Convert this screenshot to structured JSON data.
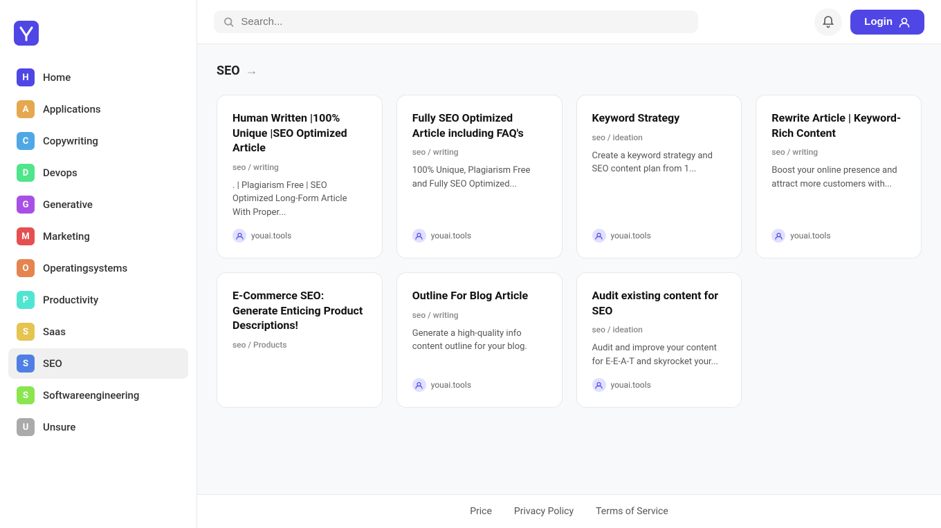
{
  "logo": {
    "alt": "Youai logo"
  },
  "sidebar": {
    "items": [
      {
        "id": "home",
        "label": "Home",
        "icon": "H",
        "color": "#4f46e5",
        "active": false
      },
      {
        "id": "applications",
        "label": "Applications",
        "icon": "A",
        "color": "#e5a84f",
        "active": false
      },
      {
        "id": "copywriting",
        "label": "Copywriting",
        "icon": "C",
        "color": "#4fa8e5",
        "active": false
      },
      {
        "id": "devops",
        "label": "Devops",
        "icon": "D",
        "color": "#4fe58a",
        "active": false
      },
      {
        "id": "generative",
        "label": "Generative",
        "icon": "G",
        "color": "#a84fe5",
        "active": false
      },
      {
        "id": "marketing",
        "label": "Marketing",
        "icon": "M",
        "color": "#e54f4f",
        "active": false
      },
      {
        "id": "operatingsystems",
        "label": "Operatingsystems",
        "icon": "O",
        "color": "#e5844f",
        "active": false
      },
      {
        "id": "productivity",
        "label": "Productivity",
        "icon": "P",
        "color": "#4fe5d0",
        "active": false
      },
      {
        "id": "saas",
        "label": "Saas",
        "icon": "S",
        "color": "#e5c44f",
        "active": false
      },
      {
        "id": "seo",
        "label": "SEO",
        "icon": "S",
        "color": "#4f7fe5",
        "active": true
      },
      {
        "id": "softwareengineering",
        "label": "Softwareengineering",
        "icon": "S",
        "color": "#8ae54f",
        "active": false
      },
      {
        "id": "unsure",
        "label": "Unsure",
        "icon": "U",
        "color": "#aaa",
        "active": false
      }
    ]
  },
  "topbar": {
    "search_placeholder": "Search...",
    "login_label": "Login"
  },
  "breadcrumb": {
    "category": "SEO",
    "arrow": "→"
  },
  "cards": [
    {
      "id": "card-1",
      "title": "Human Written |100% Unique |SEO Optimized Article",
      "tag": "seo / writing",
      "description": ". | Plagiarism Free | SEO Optimized Long-Form Article With Proper...",
      "author": "youai.tools"
    },
    {
      "id": "card-2",
      "title": "Fully SEO Optimized Article including FAQ's",
      "tag": "seo / writing",
      "description": "100% Unique, Plagiarism Free and Fully SEO Optimized...",
      "author": "youai.tools"
    },
    {
      "id": "card-3",
      "title": "Keyword Strategy",
      "tag": "seo / ideation",
      "description": "Create a keyword strategy and SEO content plan from 1...",
      "author": "youai.tools"
    },
    {
      "id": "card-4",
      "title": "Rewrite Article | Keyword-Rich Content",
      "tag": "seo / writing",
      "description": "Boost your online presence and attract more customers with...",
      "author": "youai.tools"
    },
    {
      "id": "card-5",
      "title": "E-Commerce SEO: Generate Enticing Product Descriptions!",
      "tag": "seo / Products",
      "description": "",
      "author": ""
    },
    {
      "id": "card-6",
      "title": "Outline For Blog Article",
      "tag": "seo / writing",
      "description": "Generate a high-quality info content outline for your blog.",
      "author": "youai.tools"
    },
    {
      "id": "card-7",
      "title": "Audit existing content for SEO",
      "tag": "seo / ideation",
      "description": "Audit and improve your content for E-E-A-T and skyrocket your...",
      "author": "youai.tools"
    }
  ],
  "footer": {
    "links": [
      {
        "id": "price",
        "label": "Price"
      },
      {
        "id": "privacy-policy",
        "label": "Privacy Policy"
      },
      {
        "id": "terms-of-service",
        "label": "Terms of Service"
      }
    ]
  }
}
